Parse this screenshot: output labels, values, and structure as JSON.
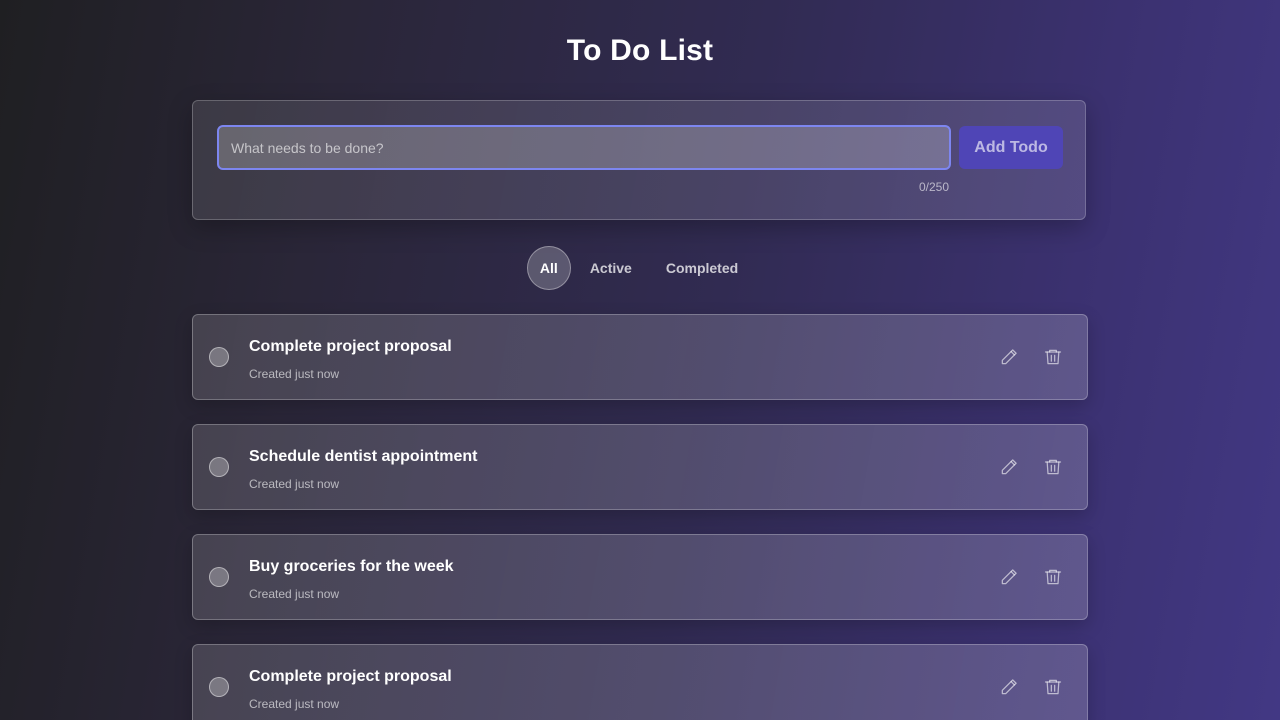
{
  "header": {
    "title": "To Do List"
  },
  "input_card": {
    "placeholder": "What needs to be done?",
    "value": "",
    "add_button_label": "Add Todo",
    "char_counter": "0/250"
  },
  "filters": {
    "items": [
      {
        "label": "All",
        "active": true
      },
      {
        "label": "Active",
        "active": false
      },
      {
        "label": "Completed",
        "active": false
      }
    ]
  },
  "todos": [
    {
      "title": "Complete project proposal",
      "meta": "Created just now",
      "completed": false
    },
    {
      "title": "Schedule dentist appointment",
      "meta": "Created just now",
      "completed": false
    },
    {
      "title": "Buy groceries for the week",
      "meta": "Created just now",
      "completed": false
    },
    {
      "title": "Complete project proposal",
      "meta": "Created just now",
      "completed": false
    }
  ],
  "icons": {
    "edit": "pencil-icon",
    "delete": "trash-icon"
  },
  "colors": {
    "accent": "#4f45b6",
    "input_focus_border": "#7d86f0"
  }
}
